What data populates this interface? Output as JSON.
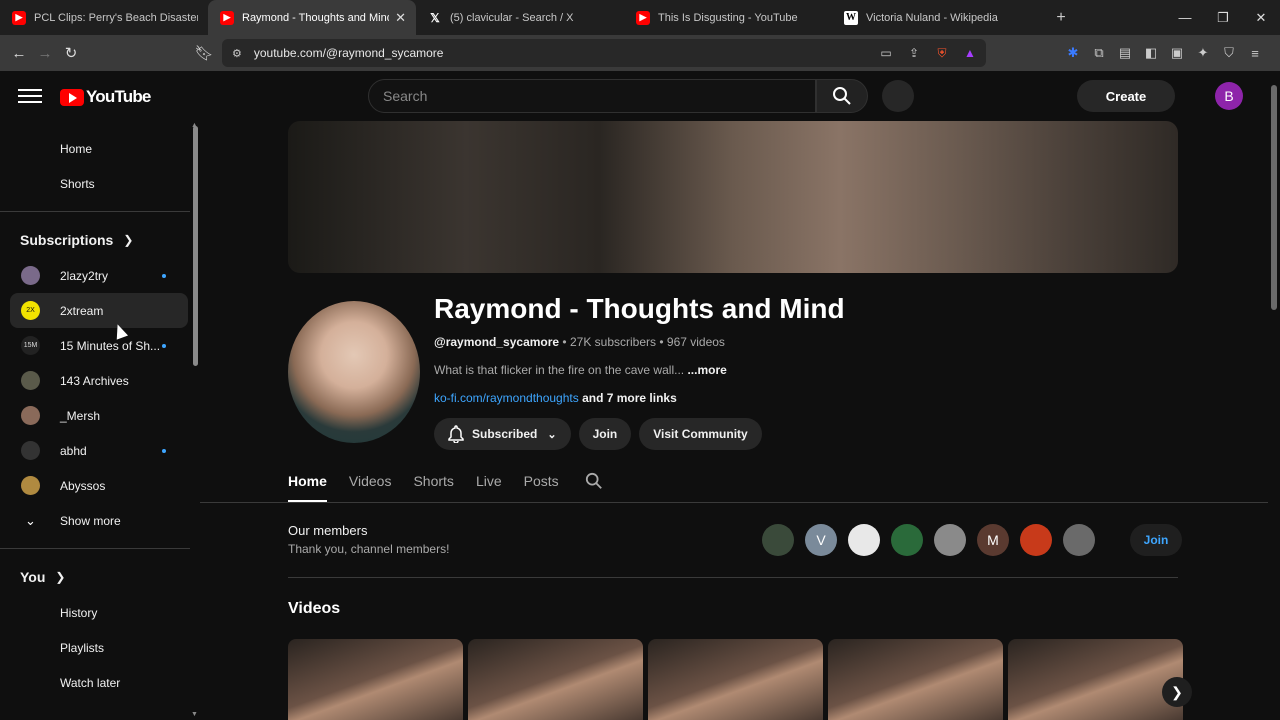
{
  "browser": {
    "tabs": [
      {
        "title": "PCL Clips: Perry's Beach Disaster - Yo",
        "favicon": "youtube",
        "active": false
      },
      {
        "title": "Raymond - Thoughts and Mind",
        "favicon": "youtube",
        "active": true
      },
      {
        "title": "(5) clavicular - Search / X",
        "favicon": "x",
        "active": false
      },
      {
        "title": "This Is Disgusting - YouTube",
        "favicon": "youtube",
        "active": false
      },
      {
        "title": "Victoria Nuland - Wikipedia",
        "favicon": "wikipedia",
        "active": false
      }
    ],
    "url": "youtube.com/@raymond_sycamore"
  },
  "header": {
    "logo_text": "YouTube",
    "search_placeholder": "Search",
    "create_label": "Create",
    "account_initial": "B"
  },
  "sidebar": {
    "home": "Home",
    "shorts": "Shorts",
    "subscriptions_heading": "Subscriptions",
    "subscriptions": [
      {
        "name": "2lazy2try",
        "new": true,
        "color": "#7a6a8a",
        "badge": ""
      },
      {
        "name": "2xtream",
        "new": false,
        "color": "#f2e300",
        "badge": "2X"
      },
      {
        "name": "15 Minutes of Sh...",
        "new": true,
        "color": "#222222",
        "badge": "15M"
      },
      {
        "name": "143 Archives",
        "new": false,
        "color": "#5a5a4a",
        "badge": ""
      },
      {
        "name": "_Mersh",
        "new": false,
        "color": "#8a6a5a",
        "badge": ""
      },
      {
        "name": "abhd",
        "new": true,
        "color": "#333333",
        "badge": ""
      },
      {
        "name": "Abyssos",
        "new": false,
        "color": "#b08a40",
        "badge": ""
      }
    ],
    "show_more": "Show more",
    "you_heading": "You",
    "you_items": [
      "History",
      "Playlists",
      "Watch later"
    ]
  },
  "channel": {
    "name": "Raymond - Thoughts and Mind",
    "handle": "@raymond_sycamore",
    "subscribers": "27K subscribers",
    "videos_count": "967 videos",
    "description": "What is that flicker in the fire on the cave wall...",
    "more_label": "...more",
    "link": "ko-fi.com/raymondthoughts",
    "more_links": "and 7 more links",
    "subscribed_label": "Subscribed",
    "join_label": "Join",
    "community_label": "Visit Community"
  },
  "channel_tabs": [
    "Home",
    "Videos",
    "Shorts",
    "Live",
    "Posts"
  ],
  "members": {
    "title": "Our members",
    "subtitle": "Thank you, channel members!",
    "avatars": [
      {
        "initial": "",
        "color": "#3a4a3a"
      },
      {
        "initial": "V",
        "color": "#7a8a9a"
      },
      {
        "initial": "",
        "color": "#e8e8e8"
      },
      {
        "initial": "",
        "color": "#2a6a3a"
      },
      {
        "initial": "",
        "color": "#8a8a8a"
      },
      {
        "initial": "M",
        "color": "#5a3a30"
      },
      {
        "initial": "",
        "color": "#c83a1a"
      },
      {
        "initial": "",
        "color": "#6a6a6a"
      }
    ],
    "join_label": "Join"
  },
  "videos_section": {
    "title": "Videos",
    "thumbnail_count": 5
  }
}
